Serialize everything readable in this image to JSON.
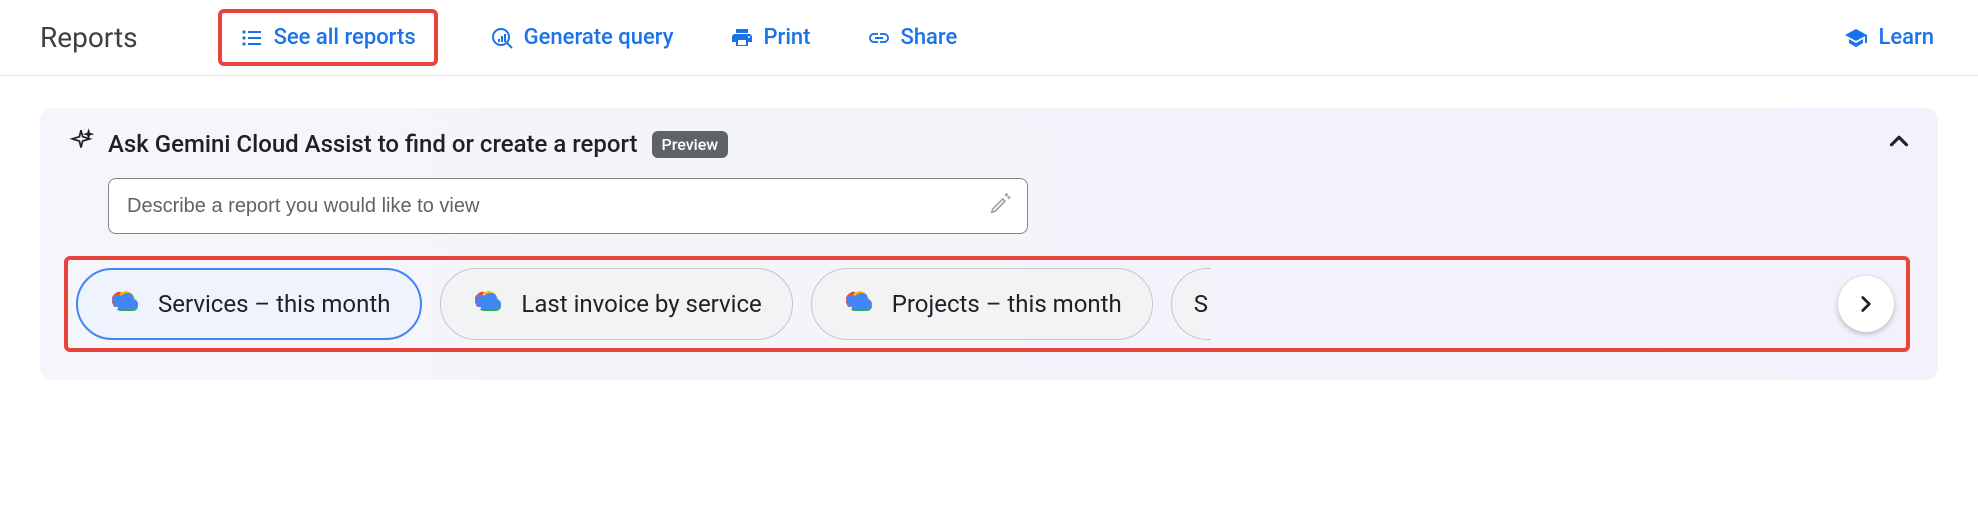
{
  "header": {
    "title": "Reports",
    "actions": {
      "see_all_reports": "See all reports",
      "generate_query": "Generate query",
      "print": "Print",
      "share": "Share",
      "learn": "Learn"
    }
  },
  "gemini": {
    "title": "Ask Gemini Cloud Assist to find or create a report",
    "badge": "Preview",
    "placeholder": "Describe a report you would like to view",
    "chips": {
      "services_month": "Services – this month",
      "last_invoice": "Last invoice by service",
      "projects_month": "Projects – this month",
      "peek": "S"
    }
  },
  "colors": {
    "accent": "#1a73e8",
    "highlight": "#e8443a",
    "badge_bg": "#5f6368"
  }
}
